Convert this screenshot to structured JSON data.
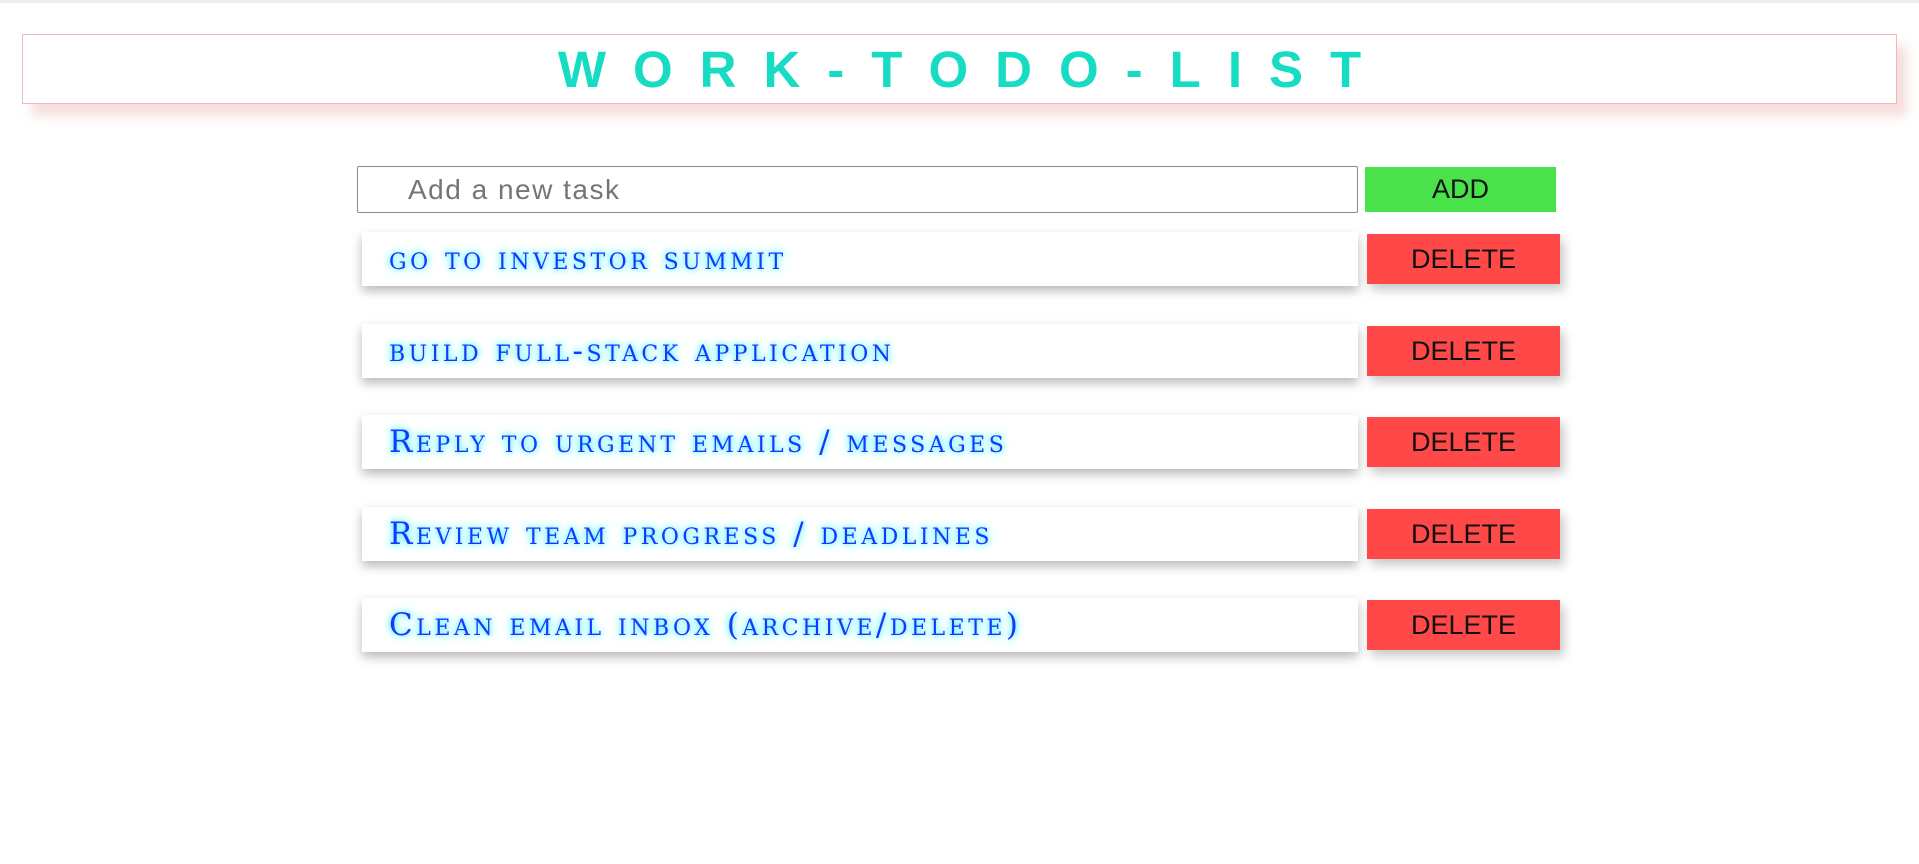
{
  "header": {
    "title": "WORK-TODO-LIST"
  },
  "add_form": {
    "placeholder": "Add a new task",
    "value": "",
    "add_label": "ADD"
  },
  "tasks": [
    {
      "text": "go to investor summit",
      "delete_label": "DELETE"
    },
    {
      "text": "build full-stack application",
      "delete_label": "DELETE"
    },
    {
      "text": "Reply to urgent emails / messages",
      "delete_label": "DELETE"
    },
    {
      "text": "Review team progress / deadlines",
      "delete_label": "DELETE"
    },
    {
      "text": "Clean email inbox (archive/delete)",
      "delete_label": "DELETE"
    }
  ],
  "colors": {
    "title": "#17dcc4",
    "add_button": "#4ae24a",
    "delete_button": "#ff4848",
    "task_text": "#1a35ff",
    "task_glow": "#3ff0ff"
  }
}
